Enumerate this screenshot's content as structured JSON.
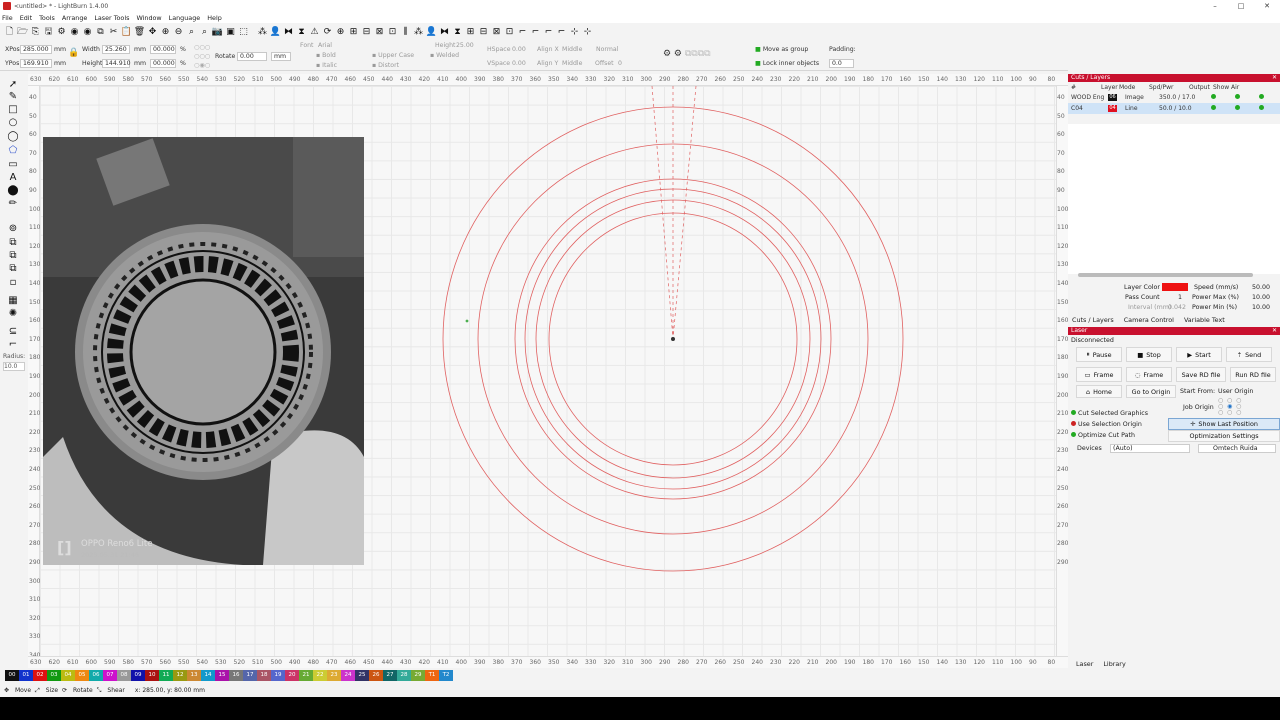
{
  "window": {
    "title": "<untitled> * - LightBurn 1.4.00"
  },
  "menu": [
    "File",
    "Edit",
    "Tools",
    "Arrange",
    "Laser Tools",
    "Window",
    "Language",
    "Help"
  ],
  "numeric": {
    "xpos_label": "XPos",
    "xpos": "285.000",
    "ypos_label": "YPos",
    "ypos": "169.910",
    "unit": "mm",
    "width_label": "Width",
    "width": "25.260",
    "height_label": "Height",
    "height": "144.910",
    "pct1": "00.000",
    "pct2": "00.000",
    "pct": "%",
    "rotate_label": "Rotate",
    "rotate": "0.00",
    "rot_unit": "mm"
  },
  "text_tools": {
    "font_label": "Font",
    "font": "Arial",
    "height_label": "Height",
    "height": "25.00",
    "hspace_label": "HSpace",
    "hspace": "0.00",
    "vspace_label": "VSpace",
    "vspace": "0.00",
    "bold": "Bold",
    "italic": "Italic",
    "upper": "Upper Case",
    "distort": "Distort",
    "welded": "Welded",
    "align_x_label": "Align X",
    "align_x": "Middle",
    "align_y_label": "Align Y",
    "align_y": "Middle",
    "normal": "Normal",
    "offset_label": "Offset",
    "offset": "0",
    "move_group": "Move as group",
    "lock_inner": "Lock inner objects",
    "padding_label": "Padding:",
    "padding": "0.0"
  },
  "left": {
    "radius_label": "Radius:",
    "radius": "10.0"
  },
  "ruler": {
    "top": [
      "630",
      "620",
      "610",
      "600",
      "590",
      "580",
      "570",
      "560",
      "550",
      "540",
      "530",
      "520",
      "510",
      "500",
      "490",
      "480",
      "470",
      "460",
      "450",
      "440",
      "430",
      "420",
      "410",
      "400",
      "390",
      "380",
      "370",
      "360",
      "350",
      "340",
      "330",
      "320",
      "310",
      "300",
      "290",
      "280",
      "270",
      "260",
      "250",
      "240",
      "230",
      "220",
      "210",
      "200",
      "190",
      "180",
      "170",
      "160",
      "150",
      "140",
      "130",
      "120",
      "110",
      "100",
      "90",
      "80"
    ],
    "left": [
      "40",
      "50",
      "60",
      "70",
      "80",
      "90",
      "100",
      "110",
      "120",
      "130",
      "140",
      "150",
      "160",
      "170",
      "180",
      "190",
      "200",
      "210",
      "220",
      "230",
      "240",
      "250",
      "260",
      "270",
      "280",
      "290",
      "300",
      "310",
      "320",
      "330",
      "340"
    ],
    "right": [
      "40",
      "50",
      "60",
      "70",
      "80",
      "90",
      "100",
      "110",
      "120",
      "130",
      "140",
      "150",
      "160",
      "170",
      "180",
      "190",
      "200",
      "210",
      "220",
      "230",
      "240",
      "250",
      "260",
      "270",
      "280",
      "290"
    ]
  },
  "photo": {
    "watermark1": "OPPO Reno6 Lite",
    "watermark2": "2023.05.31 21:46",
    "logo": "[]"
  },
  "cuts": {
    "panel_title": "Cuts / Layers",
    "headers": [
      "#",
      "Layer",
      "Mode",
      "Spd/Pwr",
      "Output",
      "Show",
      "Air"
    ],
    "rows": [
      {
        "num": "WOOD Eng",
        "layer_color": "#111111",
        "layer": "06",
        "mode": "Image",
        "spdpwr": "350.0 / 17.0"
      },
      {
        "num": "C04",
        "layer_color": "#e01020",
        "layer": "04",
        "mode": "Line",
        "spdpwr": "50.0 / 10.0"
      }
    ],
    "layer_color_label": "Layer Color",
    "layer_color": "#ee1111",
    "speed_label": "Speed (mm/s)",
    "speed": "50.00",
    "pass_label": "Pass Count",
    "pass": "1",
    "interval_label": "Interval (mm)",
    "interval": "0.042",
    "pmax_label": "Power Max (%)",
    "pmax": "10.00",
    "pmin_label": "Power Min (%)",
    "pmin": "10.00",
    "tabs": [
      "Cuts / Layers",
      "Camera Control",
      "Variable Text"
    ]
  },
  "laser": {
    "panel_title": "Laser",
    "status": "Disconnected",
    "pause": "Pause",
    "stop": "Stop",
    "start": "Start",
    "send": "Send",
    "frame1": "Frame",
    "frame2": "Frame",
    "save_rd": "Save RD file",
    "run_rd": "Run RD file",
    "home": "Home",
    "go_origin": "Go to Origin",
    "start_from_label": "Start From:",
    "start_from": "User Origin",
    "job_origin": "Job Origin",
    "cut_selected": "Cut Selected Graphics",
    "use_selection": "Use Selection Origin",
    "show_last": "Show Last Position",
    "optimize": "Optimize Cut Path",
    "opt_settings": "Optimization Settings",
    "devices_label": "Devices",
    "devices": "(Auto)",
    "device": "Omtech Ruida",
    "tabs": [
      "Laser",
      "Library"
    ]
  },
  "palette": [
    {
      "n": "00",
      "c": "#111111"
    },
    {
      "n": "01",
      "c": "#1133cc"
    },
    {
      "n": "02",
      "c": "#dd1111"
    },
    {
      "n": "03",
      "c": "#119911"
    },
    {
      "n": "04",
      "c": "#bbbb11"
    },
    {
      "n": "05",
      "c": "#ee8811"
    },
    {
      "n": "06",
      "c": "#11aaaa"
    },
    {
      "n": "07",
      "c": "#cc11cc"
    },
    {
      "n": "08",
      "c": "#999999"
    },
    {
      "n": "09",
      "c": "#1111aa"
    },
    {
      "n": "10",
      "c": "#aa1111"
    },
    {
      "n": "11",
      "c": "#11aa55"
    },
    {
      "n": "12",
      "c": "#999911"
    },
    {
      "n": "13",
      "c": "#cc8833"
    },
    {
      "n": "14",
      "c": "#1199cc"
    },
    {
      "n": "15",
      "c": "#aa11aa"
    },
    {
      "n": "16",
      "c": "#777777"
    },
    {
      "n": "17",
      "c": "#5566aa"
    },
    {
      "n": "18",
      "c": "#aa5566"
    },
    {
      "n": "19",
      "c": "#5566cc"
    },
    {
      "n": "20",
      "c": "#cc3366"
    },
    {
      "n": "21",
      "c": "#66aa33"
    },
    {
      "n": "22",
      "c": "#cccc33"
    },
    {
      "n": "23",
      "c": "#ddaa33"
    },
    {
      "n": "24",
      "c": "#cc33cc"
    },
    {
      "n": "25",
      "c": "#333366"
    },
    {
      "n": "26",
      "c": "#cc5511"
    },
    {
      "n": "27",
      "c": "#116666"
    },
    {
      "n": "28",
      "c": "#33aa99"
    },
    {
      "n": "29",
      "c": "#77aa33"
    },
    {
      "n": "T1",
      "c": "#ee6611"
    },
    {
      "n": "T2",
      "c": "#2288cc"
    }
  ],
  "status": {
    "move": "Move",
    "size": "Size",
    "rotate": "Rotate",
    "shear": "Shear",
    "coords": "x: 285.00, y: 80.00 mm"
  }
}
